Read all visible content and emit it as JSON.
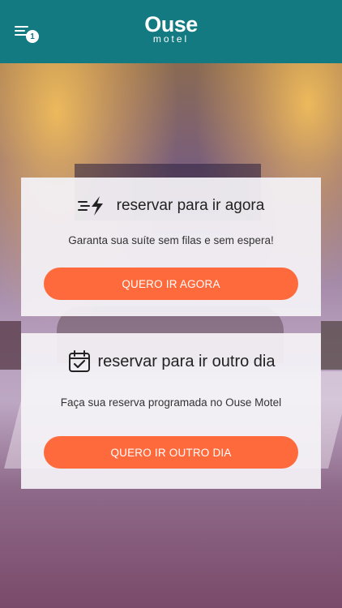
{
  "header": {
    "menu_badge": "1",
    "logo_word": "Ouse",
    "logo_sub": "motel",
    "bg_color": "#137a82"
  },
  "cards": {
    "now": {
      "icon": "lightning-speed-icon",
      "title": "reservar para ir agora",
      "description": "Garanta sua suíte sem filas e sem espera!",
      "button": "QUERO IR AGORA"
    },
    "later": {
      "icon": "calendar-check-icon",
      "title": "reservar para ir outro dia",
      "description": "Faça sua reserva programada no Ouse Motel",
      "button": "QUERO IR OUTRO DIA"
    }
  },
  "colors": {
    "accent": "#ff6a3d",
    "header": "#137a82",
    "card_bg": "#f4f2f6"
  }
}
